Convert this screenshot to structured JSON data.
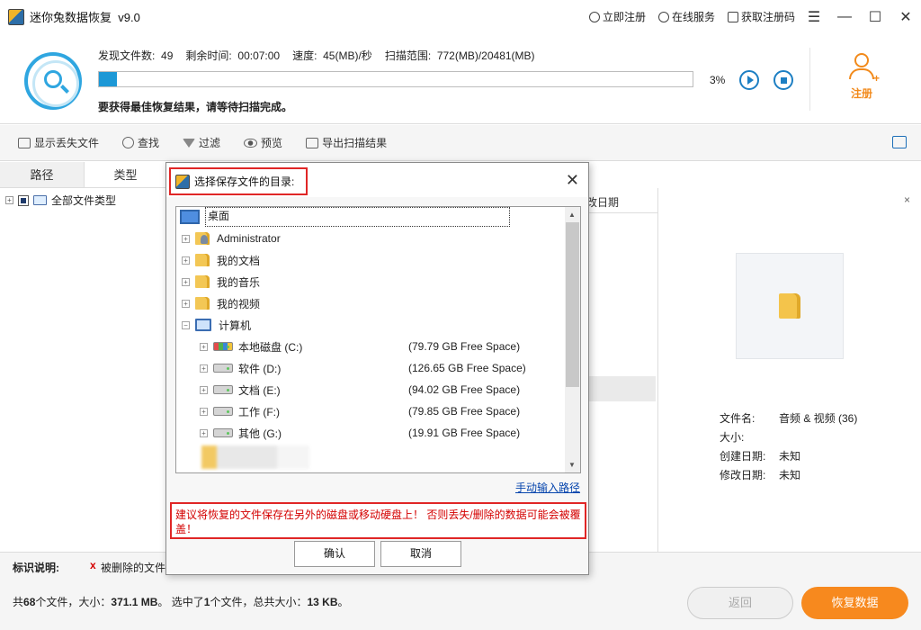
{
  "app": {
    "title": "迷你兔数据恢复",
    "version": "v9.0",
    "links": [
      {
        "icon": "key-icon",
        "label": "立即注册"
      },
      {
        "icon": "headset-icon",
        "label": "在线服务"
      },
      {
        "icon": "cart-icon",
        "label": "获取注册码"
      }
    ],
    "window_controls": {
      "menu": "☰",
      "minimize": "—",
      "maximize": "☐",
      "close": "✕"
    }
  },
  "scan": {
    "found_label": "发现文件数:",
    "found_value": "49",
    "remaining_label": "剩余时间:",
    "remaining_value": "00:07:00",
    "speed_label": "速度:",
    "speed_value": "45(MB)/秒",
    "range_label": "扫描范围:",
    "range_value": "772(MB)/20481(MB)",
    "progress_percent": 3,
    "percent_label": "3%",
    "hint": "要获得最佳恢复结果，请等待扫描完成。",
    "register_label": "注册"
  },
  "toolbar": {
    "show_lost": "显示丢失文件",
    "find": "查找",
    "filter": "过滤",
    "preview": "预览",
    "export": "导出扫描结果"
  },
  "tabs": {
    "path": "路径",
    "type": "类型"
  },
  "tree": {
    "root": "全部文件类型"
  },
  "middle": {
    "col_date": "改日期"
  },
  "preview": {
    "close": "×",
    "filename_label": "文件名:",
    "filename_value": "音频 & 视频 (36)",
    "size_label": "大小:",
    "size_value": "",
    "created_label": "创建日期:",
    "created_value": "未知",
    "modified_label": "修改日期:",
    "modified_value": "未知"
  },
  "legend": {
    "title": "标识说明:",
    "mark": "x",
    "deleted": "被删除的文件"
  },
  "footer": {
    "total_prefix": "共",
    "total_count": "68",
    "total_mid": "个文件，大小：",
    "total_size": "371.1 MB",
    "selected_prefix": "。 选中了",
    "selected_count": "1",
    "selected_mid": "个文件，总共大小：",
    "selected_size": "13 KB",
    "selected_suffix": "。",
    "back": "返回",
    "recover": "恢复数据"
  },
  "dialog": {
    "title": "选择保存文件的目录:",
    "close": "✕",
    "desktop": "桌面",
    "folders": [
      "Administrator",
      "我的文档",
      "我的音乐",
      "我的视频"
    ],
    "computer": "计算机",
    "drives": [
      {
        "name": "本地磁盘 (C:)",
        "space": "(79.79 GB Free Space)"
      },
      {
        "name": "软件 (D:)",
        "space": "(126.65 GB Free Space)"
      },
      {
        "name": "文档 (E:)",
        "space": "(94.02 GB Free Space)"
      },
      {
        "name": "工作 (F:)",
        "space": "(79.85 GB Free Space)"
      },
      {
        "name": "其他 (G:)",
        "space": "(19.91 GB Free Space)"
      }
    ],
    "manual_path": "手动输入路径",
    "warning": "建议将恢复的文件保存在另外的磁盘或移动硬盘上！ 否则丢失/删除的数据可能会被覆盖！",
    "confirm": "确认",
    "cancel": "取消"
  }
}
